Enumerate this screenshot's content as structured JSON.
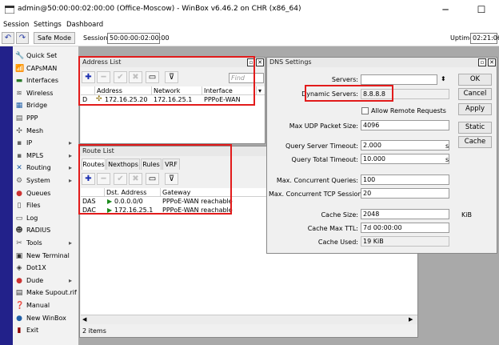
{
  "window": {
    "title": "admin@50:00:00:02:00:00 (Office-Moscow) - WinBox v6.46.2 on CHR (x86_64)",
    "minimize": "─",
    "maximize": "☐",
    "close": "✕"
  },
  "menu": {
    "items": [
      "Session",
      "Settings",
      "Dashboard"
    ]
  },
  "toolbar": {
    "undo": "↶",
    "redo": "↷",
    "safe_mode": "Safe Mode",
    "session_label": "Session:",
    "session_value": "50:00:00:02:00:00",
    "uptime_label": "Uptime:",
    "uptime_value": "02:21:06"
  },
  "sidebar": {
    "items": [
      {
        "label": "Quick Set",
        "icon": "🔧",
        "arrow": ""
      },
      {
        "label": "CAPsMAN",
        "icon": "📶",
        "arrow": ""
      },
      {
        "label": "Interfaces",
        "icon": "▬",
        "arrow": ""
      },
      {
        "label": "Wireless",
        "icon": "≋",
        "arrow": ""
      },
      {
        "label": "Bridge",
        "icon": "▦",
        "arrow": ""
      },
      {
        "label": "PPP",
        "icon": "▤",
        "arrow": ""
      },
      {
        "label": "Mesh",
        "icon": "✣",
        "arrow": ""
      },
      {
        "label": "IP",
        "icon": "▪",
        "arrow": "▸"
      },
      {
        "label": "MPLS",
        "icon": "▪",
        "arrow": "▸"
      },
      {
        "label": "Routing",
        "icon": "✕",
        "arrow": "▸"
      },
      {
        "label": "System",
        "icon": "⚙",
        "arrow": "▸"
      },
      {
        "label": "Queues",
        "icon": "●",
        "arrow": ""
      },
      {
        "label": "Files",
        "icon": "▯",
        "arrow": ""
      },
      {
        "label": "Log",
        "icon": "▭",
        "arrow": ""
      },
      {
        "label": "RADIUS",
        "icon": "☻",
        "arrow": ""
      },
      {
        "label": "Tools",
        "icon": "✂",
        "arrow": "▸"
      },
      {
        "label": "New Terminal",
        "icon": "▣",
        "arrow": ""
      },
      {
        "label": "Dot1X",
        "icon": "◈",
        "arrow": ""
      },
      {
        "label": "Dude",
        "icon": "●",
        "arrow": "▸"
      },
      {
        "label": "Make Supout.rif",
        "icon": "▤",
        "arrow": ""
      },
      {
        "label": "Manual",
        "icon": "❓",
        "arrow": ""
      },
      {
        "label": "New WinBox",
        "icon": "●",
        "arrow": ""
      },
      {
        "label": "Exit",
        "icon": "▮",
        "arrow": ""
      }
    ]
  },
  "address_list": {
    "title": "Address List",
    "find_placeholder": "Find",
    "columns": [
      "Address",
      "Network",
      "Interface"
    ],
    "rows": [
      {
        "flag": "D",
        "address": "172.16.25.20",
        "network": "172.16.25.1",
        "interface": "PPPoE-WAN"
      }
    ]
  },
  "route_list": {
    "title": "Route List",
    "tabs": [
      "Routes",
      "Nexthops",
      "Rules",
      "VRF"
    ],
    "columns": [
      "Dst. Address",
      "Gateway"
    ],
    "rows": [
      {
        "flag": "DAS",
        "dst": "0.0.0.0/0",
        "gateway": "PPPoE-WAN reachable"
      },
      {
        "flag": "DAC",
        "dst": "172.16.25.1",
        "gateway": "PPPoE-WAN reachable"
      }
    ],
    "status": "2 items"
  },
  "dns": {
    "title": "DNS Settings",
    "servers_label": "Servers:",
    "servers_value": "",
    "dynamic_label": "Dynamic Servers:",
    "dynamic_value": "8.8.8.8",
    "allow_remote_label": "Allow Remote Requests",
    "udp_label": "Max UDP Packet Size:",
    "udp_value": "4096",
    "qst_label": "Query Server Timeout:",
    "qst_value": "2.000",
    "qst_unit": "s",
    "qtt_label": "Query Total Timeout:",
    "qtt_value": "10.000",
    "qtt_unit": "s",
    "mcq_label": "Max. Concurrent Queries:",
    "mcq_value": "100",
    "mct_label": "Max. Concurrent TCP Sessions:",
    "mct_value": "20",
    "cs_label": "Cache Size:",
    "cs_value": "2048",
    "cs_unit": "KiB",
    "ttl_label": "Cache Max TTL:",
    "ttl_value": "7d 00:00:00",
    "cu_label": "Cache Used:",
    "cu_value": "19 KiB",
    "buttons": {
      "ok": "OK",
      "cancel": "Cancel",
      "apply": "Apply",
      "static": "Static",
      "cache": "Cache"
    }
  }
}
